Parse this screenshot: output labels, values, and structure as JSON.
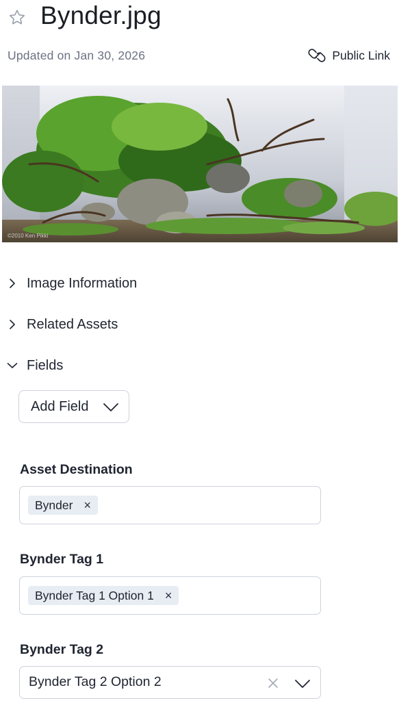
{
  "header": {
    "title": "Bynder.jpg",
    "updated": "Updated on Jan 30, 2026",
    "public_link": "Public Link"
  },
  "preview": {
    "watermark": "©2010 Ken Pikki"
  },
  "sections": [
    {
      "label": "Image Information",
      "expanded": false
    },
    {
      "label": "Related Assets",
      "expanded": false
    },
    {
      "label": "Fields",
      "expanded": true
    }
  ],
  "add_field": {
    "label": "Add Field"
  },
  "fields": {
    "asset_destination": {
      "label": "Asset Destination",
      "chips": [
        "Bynder"
      ]
    },
    "tag1": {
      "label": "Bynder Tag 1",
      "chips": [
        "Bynder Tag 1 Option 1"
      ]
    },
    "tag2": {
      "label": "Bynder Tag 2",
      "value": "Bynder Tag 2 Option 2"
    }
  },
  "icons": {
    "chip_remove": "×"
  },
  "colors": {
    "text": "#1f2430",
    "muted": "#6b7282",
    "border": "#cdd2da",
    "chip_bg": "#e8ecf3"
  }
}
